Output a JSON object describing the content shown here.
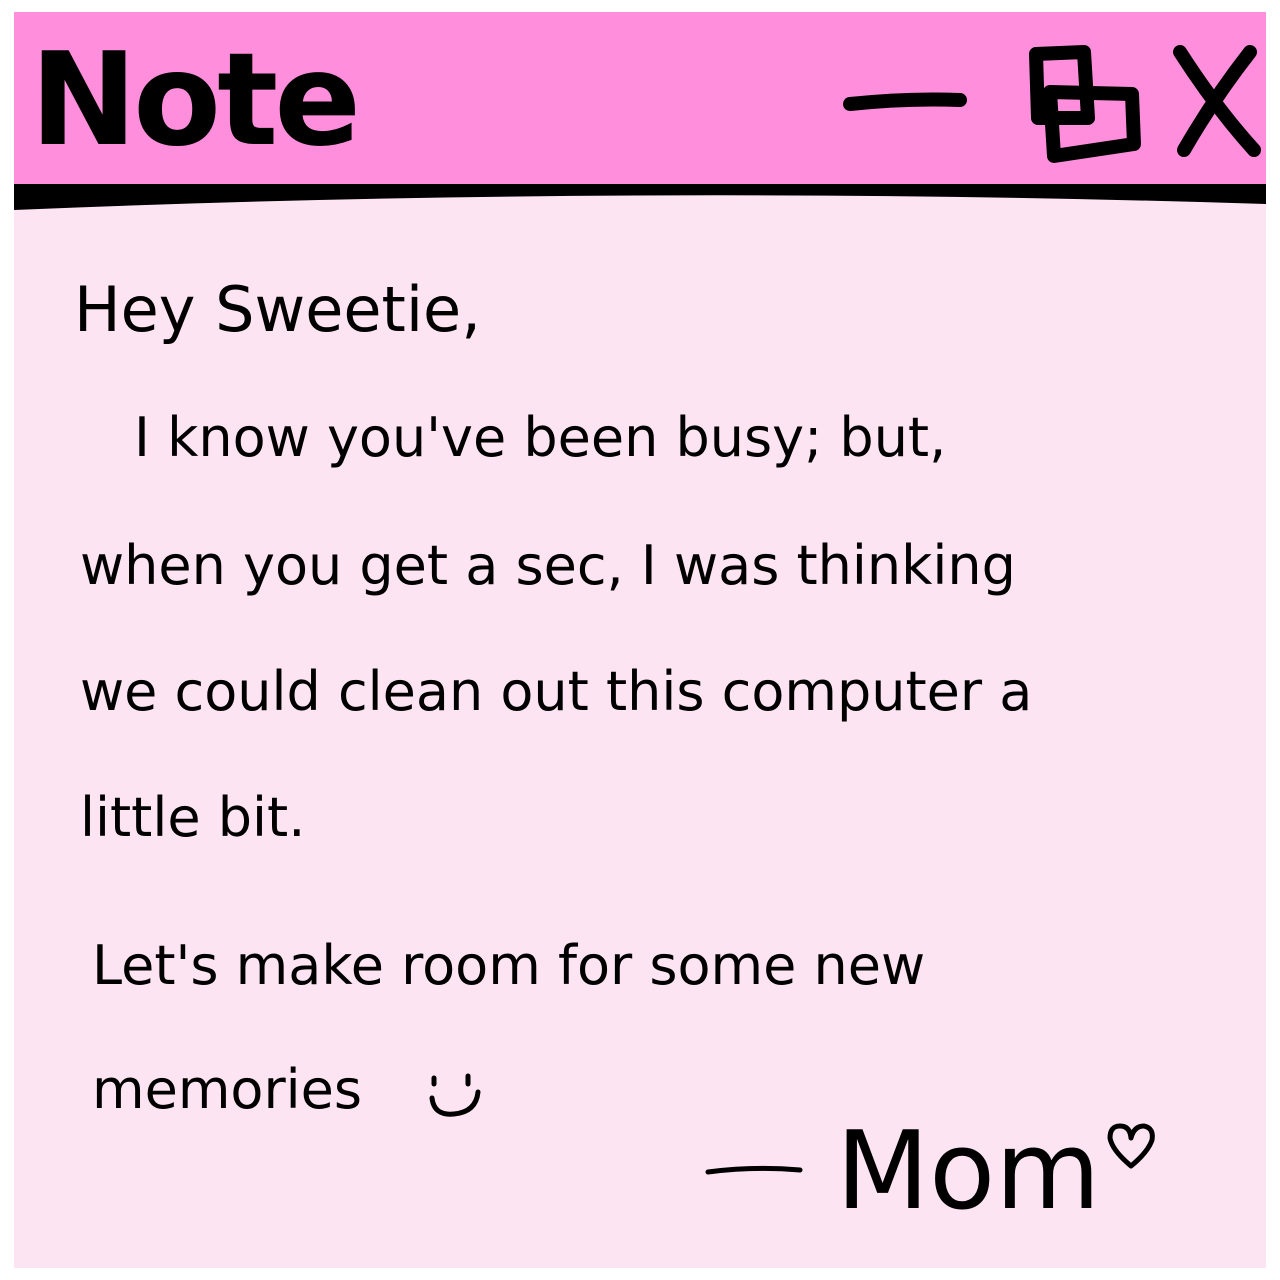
{
  "window": {
    "title": "Note",
    "colors": {
      "titlebar": "#ff8fdc",
      "body": "#fde4f2",
      "ink": "#000000"
    },
    "controls": {
      "minimize_icon": "minimize-icon",
      "maximize_icon": "maximize-icon",
      "close_icon": "close-icon"
    }
  },
  "note": {
    "greeting": "Hey Sweetie,",
    "lines": [
      "I know you've been busy; but,",
      "when you get a sec, I was thinking",
      "we could clean out this computer a",
      "little bit.",
      "Let's make room for some new",
      "memories"
    ],
    "smiley_icon": "smiley-icon",
    "signature": "Mom",
    "heart_icon": "heart-icon"
  }
}
